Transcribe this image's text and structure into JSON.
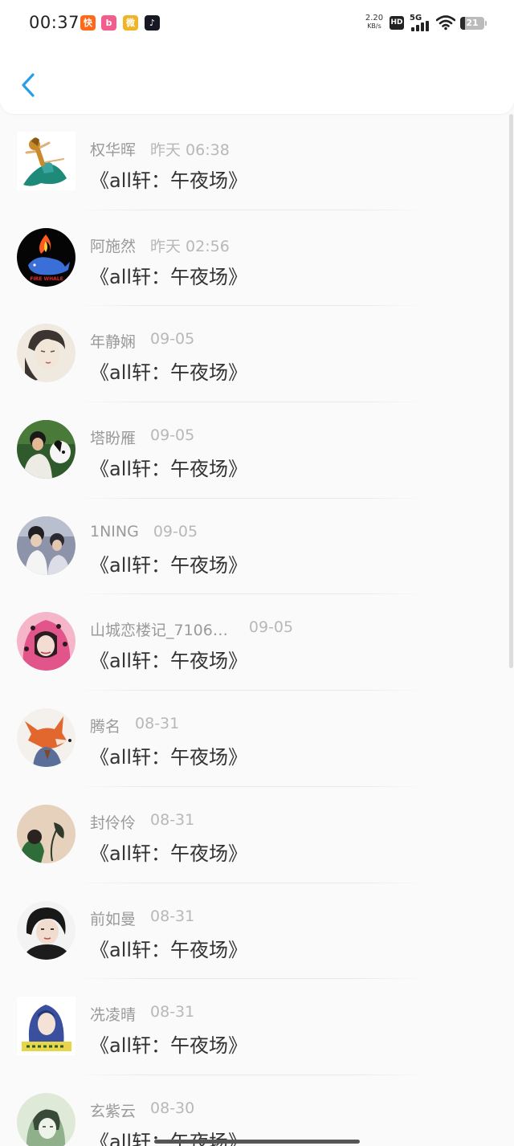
{
  "status_bar": {
    "time": "00:37",
    "net_speed_value": "2.20",
    "net_speed_unit": "KB/s",
    "hd_label": "HD",
    "network_label": "5G",
    "battery_level": "21",
    "app_icons": [
      {
        "name": "kuaishou-app-icon",
        "color": "#ff6a1a",
        "glyph": "快"
      },
      {
        "name": "bilibili-app-icon",
        "color": "#f25d8e",
        "glyph": "b"
      },
      {
        "name": "weibo-app-icon",
        "color": "#f0b429",
        "glyph": "微"
      },
      {
        "name": "douyin-app-icon",
        "color": "#161823",
        "glyph": "♪"
      }
    ]
  },
  "header": {
    "back_icon": "chevron-left-icon",
    "back_color": "#2a9de9"
  },
  "messages": [
    {
      "name": "权华晖",
      "time": "昨天 06:38",
      "message": "《all轩：午夜场》",
      "avatar": "figure-skater"
    },
    {
      "name": "阿施然",
      "time": "昨天 02:56",
      "message": "《all轩：午夜场》",
      "avatar": "fire-whale"
    },
    {
      "name": "年静娴",
      "time": "09-05",
      "message": "《all轩：午夜场》",
      "avatar": "sketch-portrait"
    },
    {
      "name": "塔盼雁",
      "time": "09-05",
      "message": "《all轩：午夜场》",
      "avatar": "person-with-dog"
    },
    {
      "name": "1NING",
      "time": "09-05",
      "message": "《all轩：午夜场》",
      "avatar": "two-people-photo"
    },
    {
      "name": "山城恋楼记_7106…",
      "time": "09-05",
      "message": "《all轩：午夜场》",
      "avatar": "pink-hood-girl"
    },
    {
      "name": "腾名",
      "time": "08-31",
      "message": "《all轩：午夜场》",
      "avatar": "cartoon-fox"
    },
    {
      "name": "封伶伶",
      "time": "08-31",
      "message": "《all轩：午夜场》",
      "avatar": "person-with-plant"
    },
    {
      "name": "前如曼",
      "time": "08-31",
      "message": "《all轩：午夜场》",
      "avatar": "boy-portrait"
    },
    {
      "name": "冼凌晴",
      "time": "08-31",
      "message": "《all轩：午夜场》",
      "avatar": "blue-hair-character"
    },
    {
      "name": "玄紫云",
      "time": "08-30",
      "message": "《all轩：午夜场》",
      "avatar": "green-sketch"
    }
  ]
}
